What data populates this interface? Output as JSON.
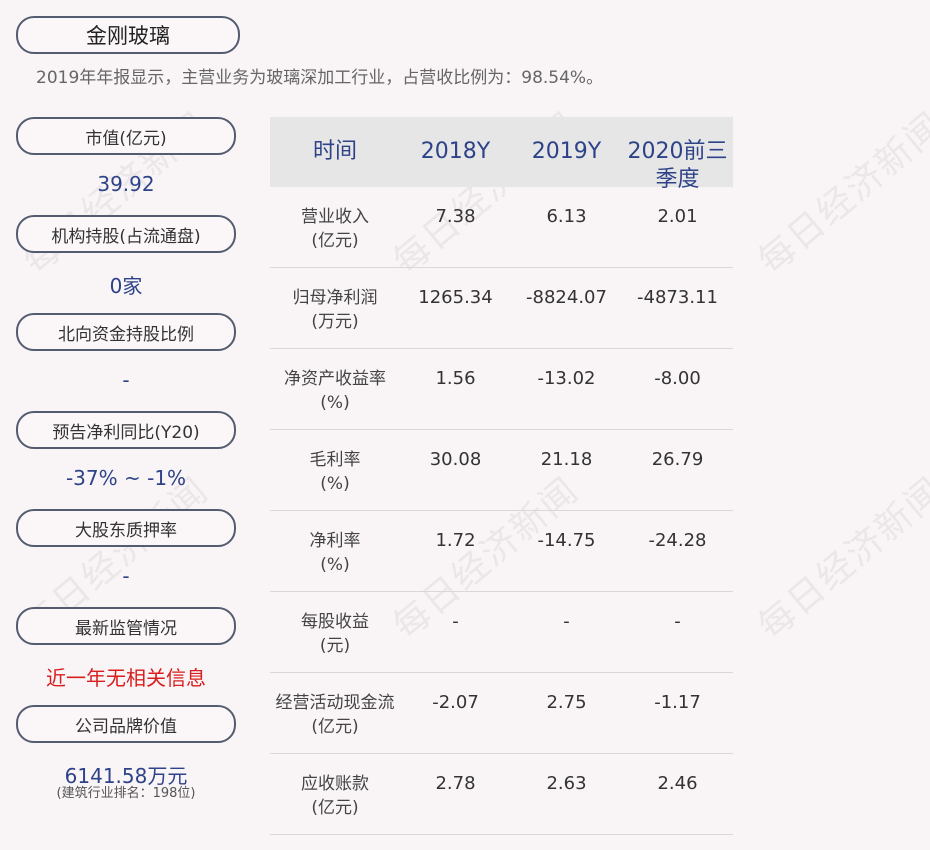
{
  "company": "金刚玻璃",
  "summary": "2019年年报显示，主营业务为玻璃深加工行业，占营收比例为：98.54%。",
  "watermark": "每日经济新闻",
  "metrics": [
    {
      "label": "市值(亿元)",
      "value": "39.92"
    },
    {
      "label": "机构持股(占流通盘)",
      "value": "0家"
    },
    {
      "label": "北向资金持股比例",
      "value": "-"
    },
    {
      "label": "预告净利同比(Y20)",
      "value": "-37% ~ -1%"
    },
    {
      "label": "大股东质押率",
      "value": "-"
    },
    {
      "label": "最新监管情况",
      "value": "近一年无相关信息"
    },
    {
      "label": "公司品牌价值",
      "value": "6141.58万元",
      "sub": "(建筑行业排名：198位)"
    }
  ],
  "table": {
    "headers": [
      "时间",
      "2018Y",
      "2019Y",
      "2020前三季度"
    ],
    "rows": [
      {
        "name": "营业收入",
        "unit": "(亿元)",
        "values": [
          "7.38",
          "6.13",
          "2.01"
        ]
      },
      {
        "name": "归母净利润",
        "unit": "(万元)",
        "values": [
          "1265.34",
          "-8824.07",
          "-4873.11"
        ]
      },
      {
        "name": "净资产收益率",
        "unit": "(%)",
        "values": [
          "1.56",
          "-13.02",
          "-8.00"
        ]
      },
      {
        "name": "毛利率",
        "unit": "(%)",
        "values": [
          "30.08",
          "21.18",
          "26.79"
        ]
      },
      {
        "name": "净利率",
        "unit": "(%)",
        "values": [
          "1.72",
          "-14.75",
          "-24.28"
        ]
      },
      {
        "name": "每股收益",
        "unit": "(元)",
        "values": [
          "-",
          "-",
          "-"
        ]
      },
      {
        "name": "经营活动现金流",
        "unit": "(亿元)",
        "values": [
          "-2.07",
          "2.75",
          "-1.17"
        ]
      },
      {
        "name": "应收账款",
        "unit": "(亿元)",
        "values": [
          "2.78",
          "2.63",
          "2.46"
        ]
      }
    ]
  }
}
